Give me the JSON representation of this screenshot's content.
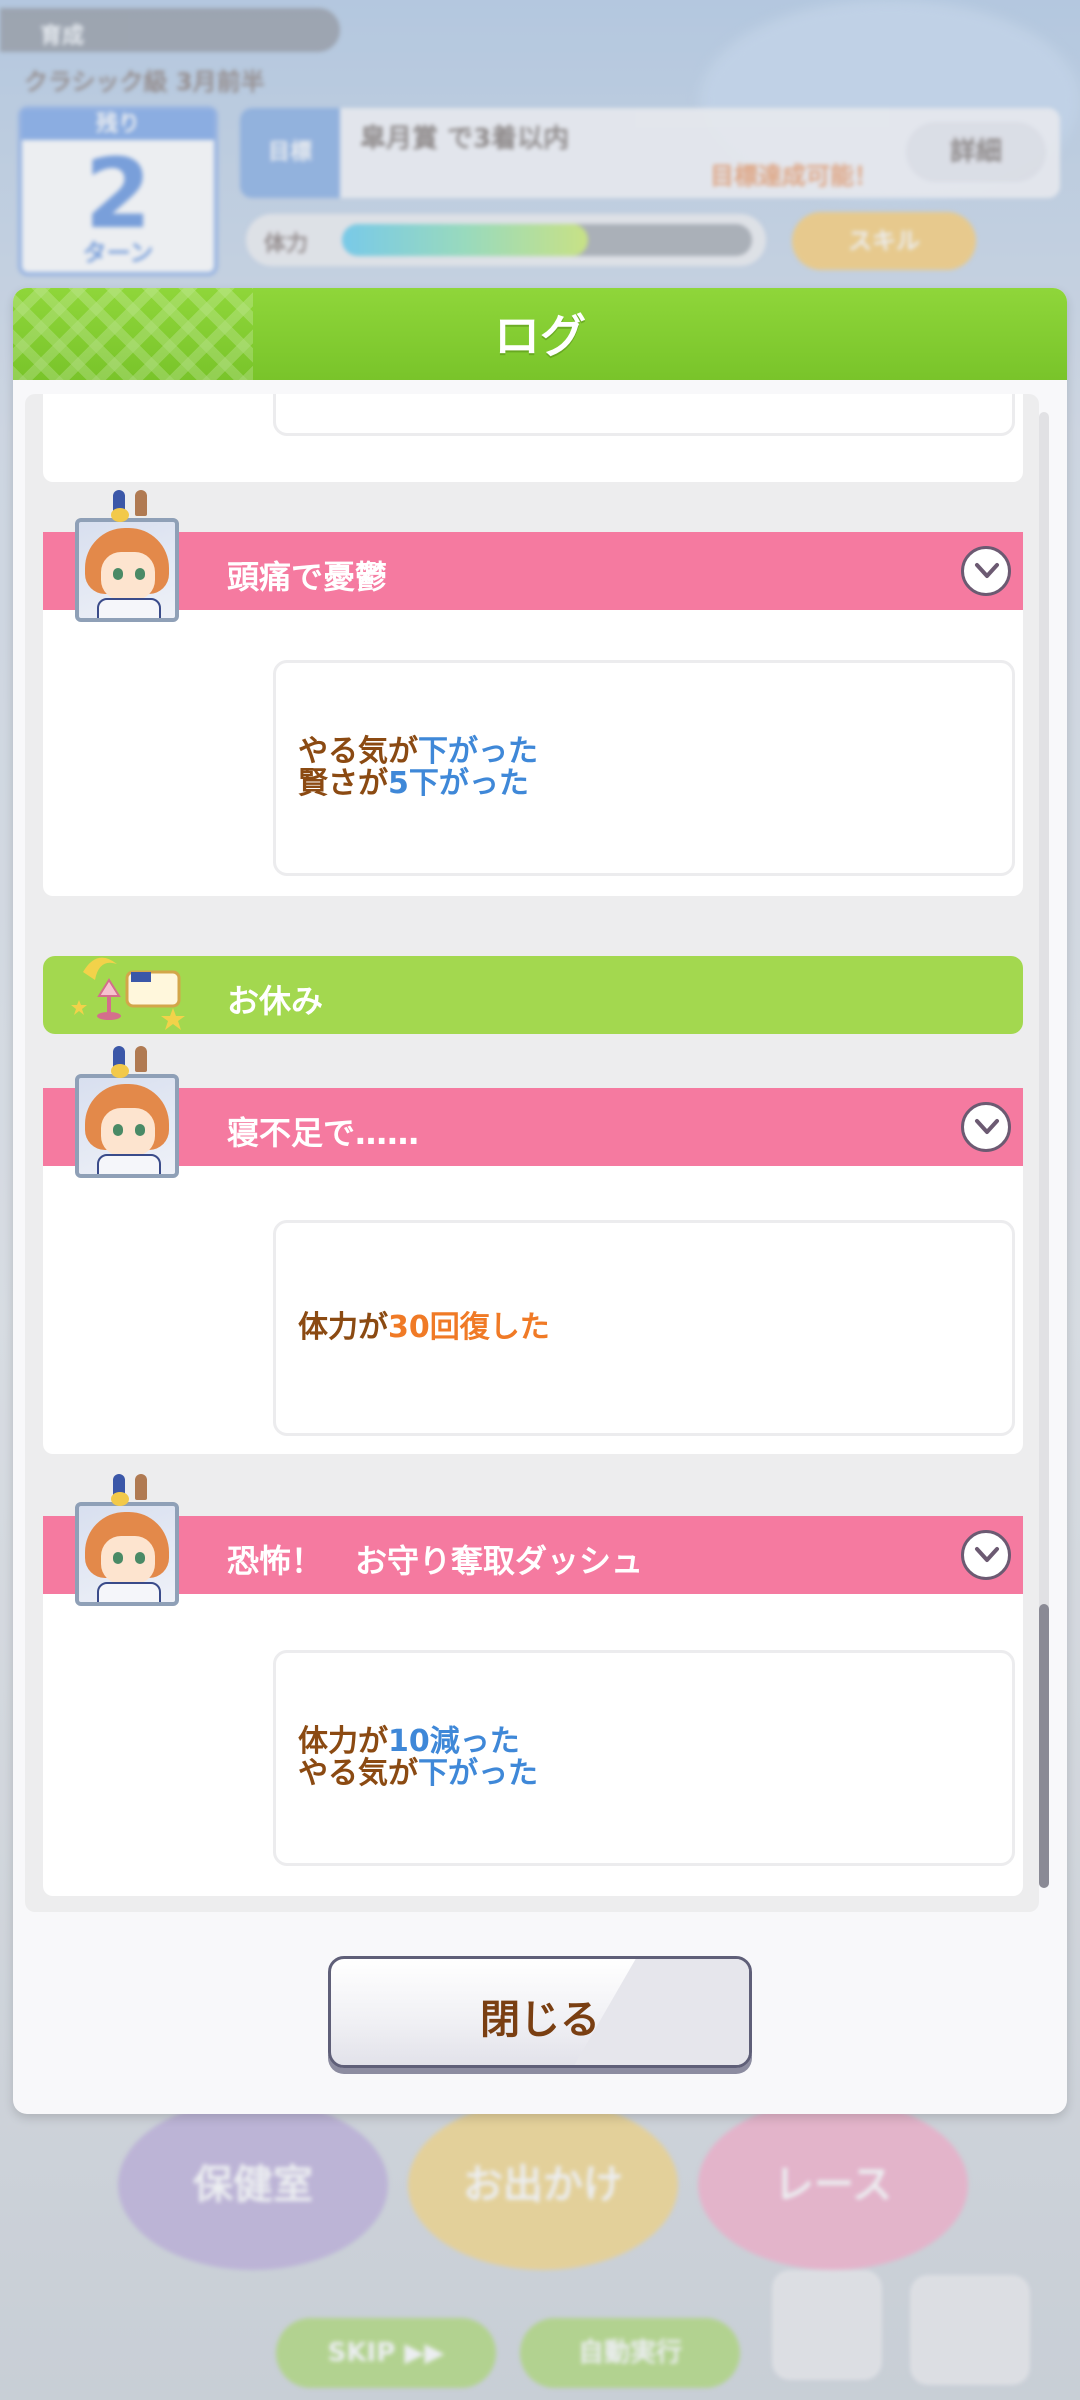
{
  "background": {
    "trainee_name": "育成",
    "subtitle": "クラシック級 3月前半",
    "turn_label": "残り",
    "turn_number": "2",
    "turn_unit": "ターン",
    "goal_tag": "目標",
    "goal_text": "皐月賞 で3着以内",
    "goal_status": "目標達成可能！",
    "goal_button": "詳細",
    "hp_label": "体力",
    "hp_level": 0.6,
    "skill_button": "スキル",
    "bottom_buttons": [
      "保健室",
      "お出かけ",
      "レース"
    ],
    "skip_button": "SKIP ▶▶",
    "auto_button": "自動実行"
  },
  "modal": {
    "title": "ログ",
    "close_label": "閉じる"
  },
  "events": [
    {
      "title": "頭痛で憂鬱",
      "lines": [
        {
          "prefix": "やる気が",
          "value": "下がった",
          "value_color": "blue"
        },
        {
          "prefix": "賢さが",
          "value": "5下がった",
          "value_color": "blue"
        }
      ]
    },
    {
      "section": "お休み"
    },
    {
      "title": "寝不足で……",
      "lines": [
        {
          "prefix": "体力が",
          "value": "30回復した",
          "value_color": "orange"
        }
      ]
    },
    {
      "title": "恐怖！　お守り奪取ダッシュ",
      "lines": [
        {
          "prefix": "体力が",
          "value": "10減った",
          "value_color": "blue"
        },
        {
          "prefix": "やる気が",
          "value": "下がった",
          "value_color": "blue"
        }
      ]
    }
  ],
  "colors": {
    "header_green": "#8fd63a",
    "event_pink": "#f57aa0",
    "rest_green": "#a3d84f",
    "text_brown": "#8b4a12",
    "value_blue": "#3f88d8",
    "value_orange": "#f07a26"
  }
}
